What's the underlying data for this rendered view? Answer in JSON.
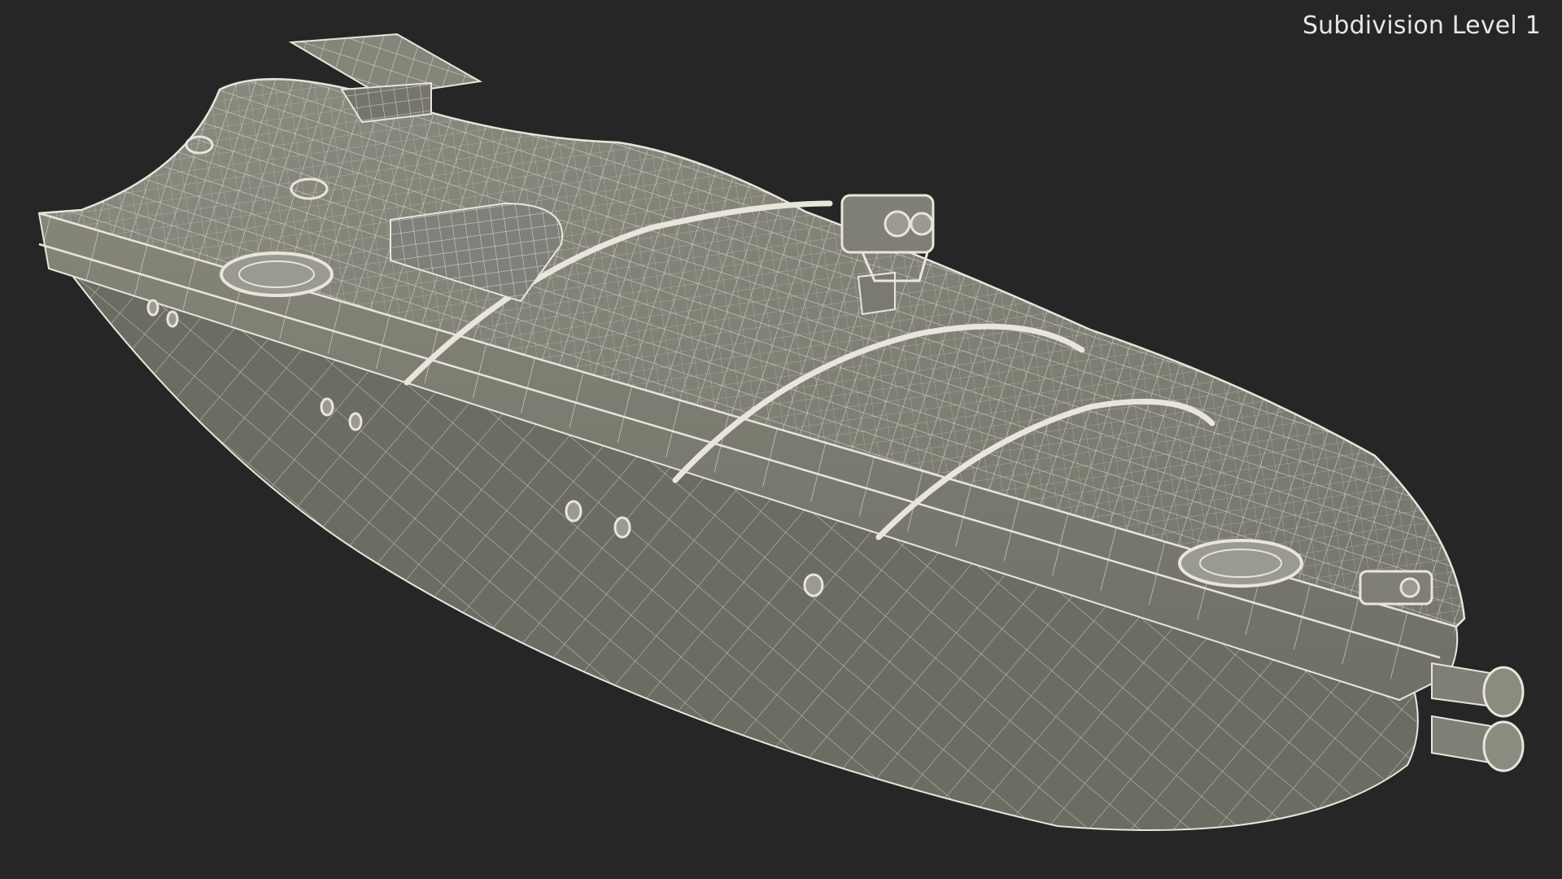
{
  "viewport": {
    "overlay_label": "Subdivision Level 1",
    "background_color": "#262626",
    "model_surface_color": "#7d7d72",
    "wire_color": "#e8e6dc"
  },
  "model": {
    "subject": "boat-hull-wireframe"
  }
}
